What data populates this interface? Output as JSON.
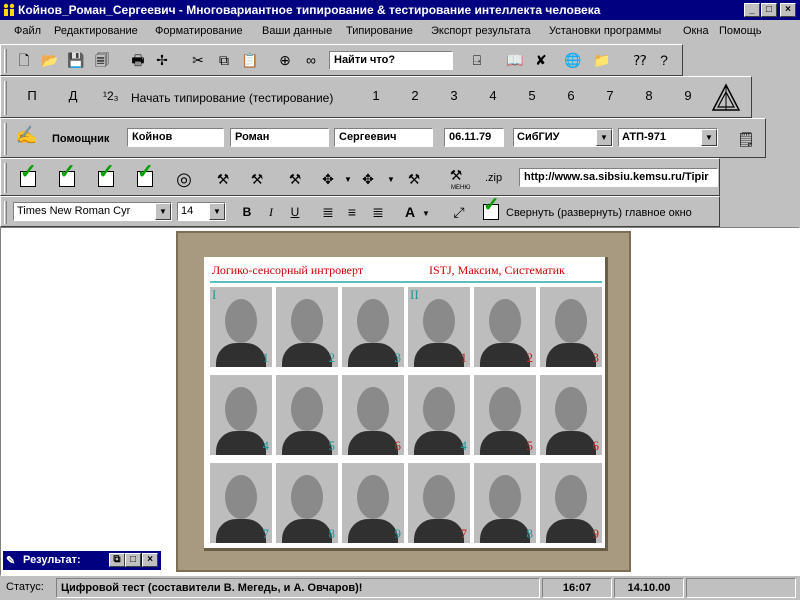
{
  "window": {
    "title": "Койнов_Роман_Сергеевич - Многовариантное типирование & тестирование интеллекта человека",
    "min": "_",
    "max": "□",
    "close": "×"
  },
  "menu": [
    "Файл",
    "Редактирование",
    "Форматирование",
    "Ваши данные",
    "Типирование",
    "Экспорт результата",
    "Установки программы",
    "Окна",
    "Помощь"
  ],
  "toolbar1": {
    "search_value": "Найти что?",
    "icons": [
      "new-file",
      "open-folder",
      "save",
      "save-all",
      "print",
      "print-preview",
      "cut",
      "copy",
      "paste",
      "target",
      "binoculars",
      "exit-door",
      "book",
      "delete-x",
      "globe",
      "folder-open",
      "help-query",
      "help"
    ]
  },
  "toolbar2": {
    "btn_p": "П",
    "btn_d": "Д",
    "counter_glyph": "¹2₃",
    "start_label": "Начать типирование (тестирование)",
    "numbers": [
      "1",
      "2",
      "3",
      "4",
      "5",
      "6",
      "7",
      "8",
      "9"
    ]
  },
  "toolbar3": {
    "assistant_label": "Помощник",
    "last_name": "Койнов",
    "first_name": "Роман",
    "patronymic": "Сергеевич",
    "birth_date": "06.11.79",
    "university": "СибГИУ",
    "group": "АТП-971"
  },
  "toolbar4": {
    "url": "http://www.sa.sibsiu.kemsu.ru/Tipir",
    "menu_text": "МЕНЮ",
    "zip_text": ".zip"
  },
  "toolbar5": {
    "font_name": "Times New Roman Cyr",
    "font_size": "14",
    "bold": "B",
    "italic": "I",
    "underline": "U",
    "collapse_label": "Свернуть (развернуть) главное окно"
  },
  "picture": {
    "title_left": "Логико-сенсорный интроверт",
    "title_right": "ISTJ, Максим, Систематик",
    "rows": [
      [
        {
          "corner": "I",
          "label": "1",
          "label_color": "#1a9a9a"
        },
        {
          "corner": "",
          "label": "2",
          "label_color": "#1a9a9a"
        },
        {
          "corner": "",
          "label": "3",
          "label_color": "#1a9a9a"
        },
        {
          "corner": "II",
          "label": "1",
          "label_color": "#c02020"
        },
        {
          "corner": "",
          "label": "2",
          "label_color": "#c02020"
        },
        {
          "corner": "",
          "label": "3",
          "label_color": "#c02020"
        }
      ],
      [
        {
          "corner": "",
          "label": "4",
          "label_color": "#1a9a9a"
        },
        {
          "corner": "",
          "label": "5",
          "label_color": "#1a9a9a"
        },
        {
          "corner": "",
          "label": "6",
          "label_color": "#c02020"
        },
        {
          "corner": "",
          "label": "4",
          "label_color": "#1a9a9a"
        },
        {
          "corner": "",
          "label": "5",
          "label_color": "#c02020"
        },
        {
          "corner": "",
          "label": "6",
          "label_color": "#c02020"
        }
      ],
      [
        {
          "corner": "",
          "label": "7",
          "label_color": "#1a9a9a"
        },
        {
          "corner": "",
          "label": "8",
          "label_color": "#1a9a9a"
        },
        {
          "corner": "",
          "label": "9",
          "label_color": "#1a9a9a"
        },
        {
          "corner": "",
          "label": "7",
          "label_color": "#c02020"
        },
        {
          "corner": "",
          "label": "8",
          "label_color": "#1a9a9a"
        },
        {
          "corner": "",
          "label": "9",
          "label_color": "#c02020"
        }
      ]
    ]
  },
  "result_window": {
    "title": "Результат:"
  },
  "status": {
    "label": "Статус:",
    "message": "Цифровой тест (составители В. Мегедь, и А. Овчаров)!",
    "time": "16:07",
    "date": "14.10.00"
  },
  "colors": {
    "titlebar": "#000080",
    "check": "#00a000",
    "picture_title": "#d00000"
  }
}
